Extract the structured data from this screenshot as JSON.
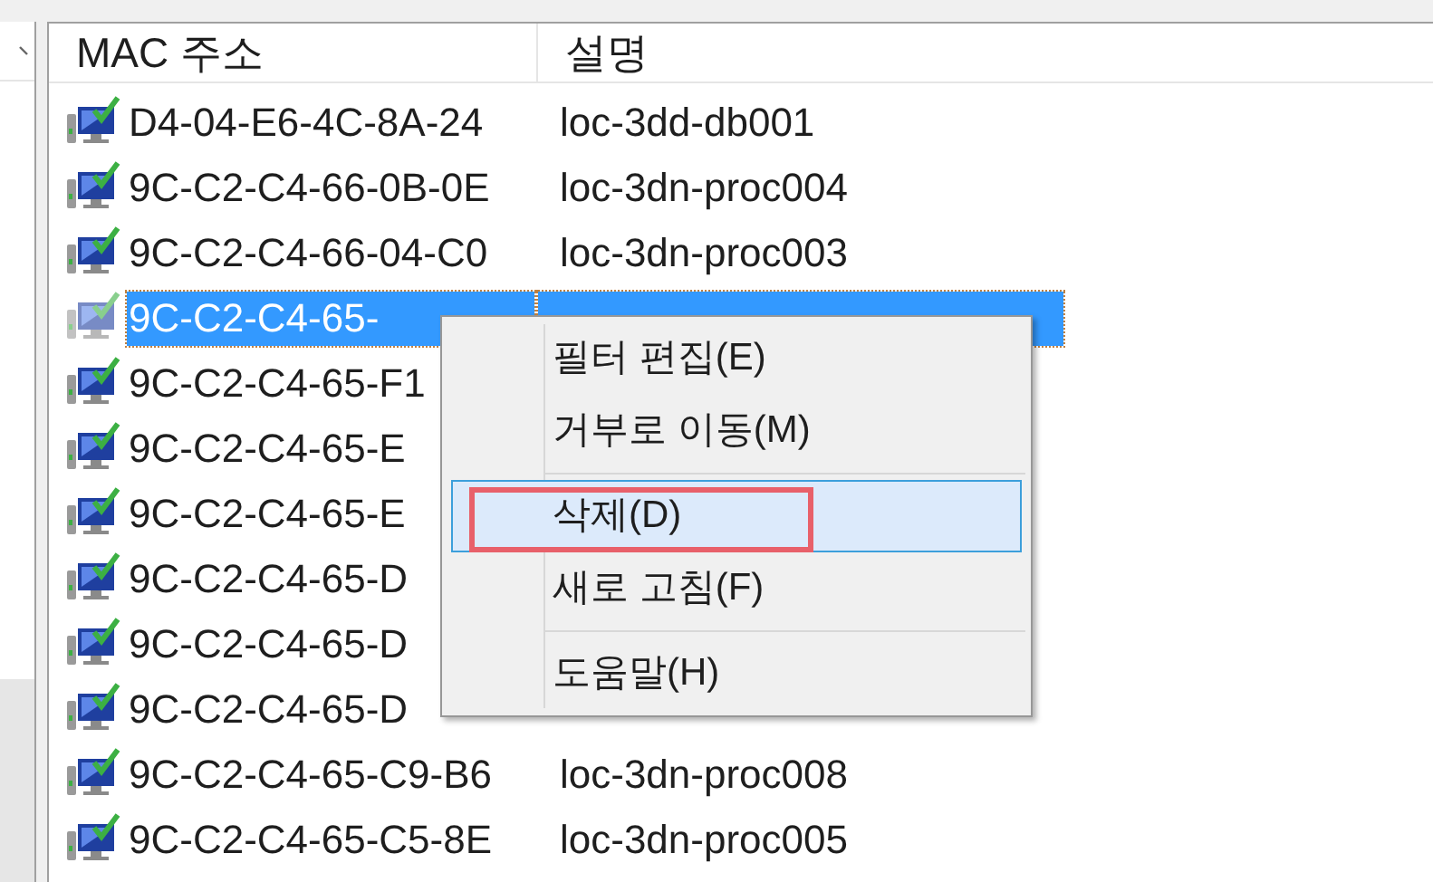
{
  "table": {
    "columns": [
      "MAC 주소",
      "설명"
    ],
    "rows": [
      {
        "mac": "D4-04-E6-4C-8A-24",
        "description": "loc-3dd-db001",
        "selected": false
      },
      {
        "mac": "9C-C2-C4-66-0B-0E",
        "description": "loc-3dn-proc004",
        "selected": false
      },
      {
        "mac": "9C-C2-C4-66-04-C0",
        "description": "loc-3dn-proc003",
        "selected": false
      },
      {
        "mac": "9C-C2-C4-65-",
        "selected": true
      },
      {
        "mac": "9C-C2-C4-65-F1",
        "selected": false
      },
      {
        "mac": "9C-C2-C4-65-E",
        "selected": false
      },
      {
        "mac": "9C-C2-C4-65-E",
        "selected": false
      },
      {
        "mac": "9C-C2-C4-65-D",
        "selected": false
      },
      {
        "mac": "9C-C2-C4-65-D",
        "selected": false
      },
      {
        "mac": "9C-C2-C4-65-D",
        "selected": false
      },
      {
        "mac": "9C-C2-C4-65-C9-B6",
        "description": "loc-3dn-proc008",
        "selected": false
      },
      {
        "mac": "9C-C2-C4-65-C5-8E",
        "description": "loc-3dn-proc005",
        "selected": false
      }
    ]
  },
  "context_menu": {
    "items": [
      {
        "kind": "item",
        "label": "필터 편집(E)",
        "selected": false,
        "annotated": false
      },
      {
        "kind": "item",
        "label": "거부로 이동(M)",
        "selected": false,
        "annotated": false
      },
      {
        "kind": "separator"
      },
      {
        "kind": "item",
        "label": "삭제(D)",
        "selected": true,
        "annotated": true
      },
      {
        "kind": "item",
        "label": "새로 고침(F)",
        "selected": false,
        "annotated": false
      },
      {
        "kind": "separator"
      },
      {
        "kind": "item",
        "label": "도움말(H)",
        "selected": false,
        "annotated": false
      }
    ]
  }
}
